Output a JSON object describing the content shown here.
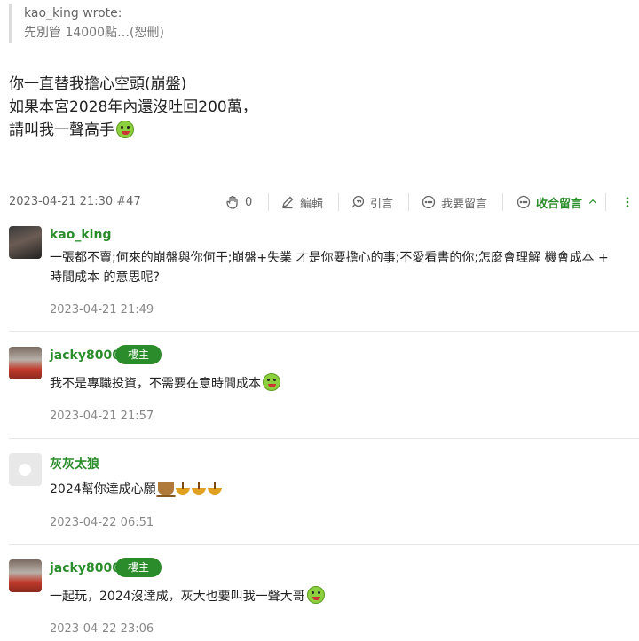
{
  "quote": {
    "author_line": "kao_king wrote:",
    "text": "先別管 14000點…(恕刪)"
  },
  "post": {
    "lines": [
      "你一直替我擔心空頭(崩盤)",
      "如果本宮2028年內還沒吐回200萬，",
      "請叫我一聲高手"
    ],
    "meta": "2023-04-21 21:30 #47",
    "actions": {
      "likes": "0",
      "edit": "編輯",
      "quote": "引言",
      "reply": "我要留言",
      "collapse": "收合留言"
    }
  },
  "comments": [
    {
      "author": "kao_king",
      "badge": "",
      "text_lines": [
        "一張都不賣;何來的崩盤與你何干;崩盤+失業 才是你要擔心的事;不愛看書的你;怎麼會理解 機會成本 +",
        "時間成本 的意思呢?"
      ],
      "time": "2023-04-21 21:49"
    },
    {
      "author": "jacky8000",
      "badge": "樓主",
      "text_lines": [
        "我不是專職投資，不需要在意時間成本"
      ],
      "time": "2023-04-21 21:57"
    },
    {
      "author": "灰灰太狼",
      "badge": "",
      "text_lines": [
        "2024幫你達成心願"
      ],
      "time": "2023-04-22 06:51"
    },
    {
      "author": "jacky8000",
      "badge": "樓主",
      "text_lines": [
        "一起玩，2024沒達成，灰大也要叫我一聲大哥"
      ],
      "time": "2023-04-22 23:06"
    }
  ],
  "colors": {
    "accent": "#2a8c2a"
  }
}
